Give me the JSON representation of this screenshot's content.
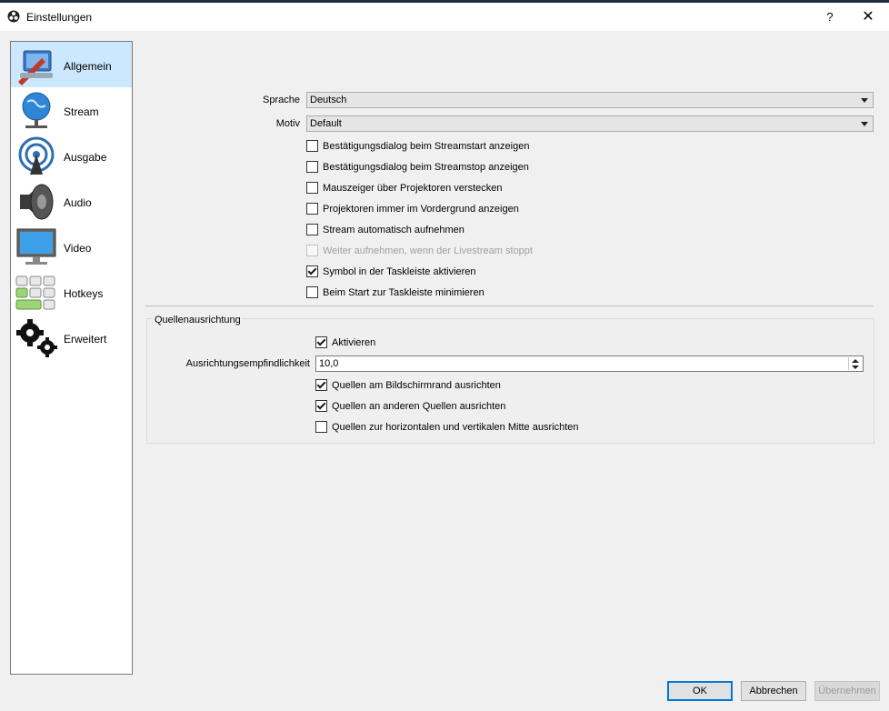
{
  "window": {
    "title": "Einstellungen",
    "help_label": "?",
    "close_label": "✕"
  },
  "sidebar": {
    "items": [
      {
        "label": "Allgemein",
        "icon": "general-settings-icon",
        "selected": true
      },
      {
        "label": "Stream",
        "icon": "stream-globe-icon",
        "selected": false
      },
      {
        "label": "Ausgabe",
        "icon": "broadcast-antenna-icon",
        "selected": false
      },
      {
        "label": "Audio",
        "icon": "speaker-icon",
        "selected": false
      },
      {
        "label": "Video",
        "icon": "monitor-icon",
        "selected": false
      },
      {
        "label": "Hotkeys",
        "icon": "keyboard-icon",
        "selected": false
      },
      {
        "label": "Erweitert",
        "icon": "gears-icon",
        "selected": false
      }
    ]
  },
  "general": {
    "language_label": "Sprache",
    "language_value": "Deutsch",
    "theme_label": "Motiv",
    "theme_value": "Default",
    "options": [
      {
        "label": "Bestätigungsdialog beim Streamstart anzeigen",
        "checked": false,
        "enabled": true
      },
      {
        "label": "Bestätigungsdialog beim Streamstop anzeigen",
        "checked": false,
        "enabled": true
      },
      {
        "label": "Mauszeiger über Projektoren verstecken",
        "checked": false,
        "enabled": true
      },
      {
        "label": "Projektoren immer im Vordergrund anzeigen",
        "checked": false,
        "enabled": true
      },
      {
        "label": "Stream automatisch aufnehmen",
        "checked": false,
        "enabled": true
      },
      {
        "label": "Weiter aufnehmen, wenn der Livestream stoppt",
        "checked": false,
        "enabled": false
      },
      {
        "label": "Symbol in der Taskleiste aktivieren",
        "checked": true,
        "enabled": true
      },
      {
        "label": "Beim Start zur Taskleiste minimieren",
        "checked": false,
        "enabled": true
      }
    ]
  },
  "snapping": {
    "group_title": "Quellenausrichtung",
    "enable_label": "Aktivieren",
    "enable_checked": true,
    "sensitivity_label": "Ausrichtungsempfindlichkeit",
    "sensitivity_value": "10,0",
    "options": [
      {
        "label": "Quellen am Bildschirmrand ausrichten",
        "checked": true
      },
      {
        "label": "Quellen an anderen Quellen ausrichten",
        "checked": true
      },
      {
        "label": "Quellen zur horizontalen und vertikalen Mitte ausrichten",
        "checked": false
      }
    ]
  },
  "buttons": {
    "ok": "OK",
    "cancel": "Abbrechen",
    "apply": "Übernehmen",
    "apply_enabled": false
  }
}
